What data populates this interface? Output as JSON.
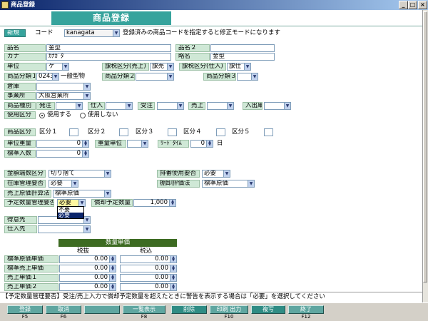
{
  "window": {
    "title": "商品登録",
    "min": "_",
    "max": "□",
    "close": "×"
  },
  "header": {
    "title": "商品登録"
  },
  "mode_badge": "新規",
  "code": {
    "label": "コード",
    "value": "kanagata",
    "hint": "登録済みの商品コードを指定すると修正モードになります"
  },
  "fields": {
    "hinmei": {
      "label": "品名",
      "value": "金型"
    },
    "hinmei2": {
      "label": "品名２",
      "value": ""
    },
    "kana": {
      "label": "カナ",
      "value": "ｶﾅｶﾞﾀ"
    },
    "ryakumei": {
      "label": "略名",
      "value": "金型"
    },
    "tani": {
      "label": "単位",
      "value": "ケ"
    },
    "tax_sales": {
      "label": "課税区分(売上)",
      "value": "課売"
    },
    "tax_purchase": {
      "label": "課税区分(仕入)",
      "value": "課仕"
    },
    "cat1": {
      "label": "商品分類１",
      "code": "0243",
      "name": "一般型物"
    },
    "cat2": {
      "label": "商品分類２",
      "value": ""
    },
    "cat3": {
      "label": "商品分類３",
      "value": ""
    },
    "souko": {
      "label": "倉庫",
      "value": ""
    },
    "jigyousho": {
      "label": "事業所",
      "value": "大阪営業所"
    },
    "shubetsu": {
      "label": "商品種別",
      "items": [
        {
          "label": "発注",
          "value": ""
        },
        {
          "label": "仕入",
          "value": ""
        },
        {
          "label": "受注",
          "value": ""
        },
        {
          "label": "売上",
          "value": ""
        },
        {
          "label": "入出庫",
          "value": ""
        }
      ]
    },
    "usage": {
      "label": "使用区分",
      "opt_use": "使用する",
      "opt_nouse": "使用しない"
    },
    "kubun": {
      "label": "商品区分",
      "items": [
        "区分１",
        "区分２",
        "区分３",
        "区分４",
        "区分５"
      ]
    },
    "tanijuryo": {
      "label": "単位重量",
      "value": "0"
    },
    "juryotani": {
      "label": "重量単位",
      "value": ""
    },
    "leadtime": {
      "label": "ﾘｰﾄﾞﾀｲﾑ",
      "value": "0",
      "unit": "日"
    },
    "hyojun_iri": {
      "label": "標準入数",
      "value": "0"
    },
    "hasu": {
      "label": "金額端数区分",
      "value": "切り捨て"
    },
    "haiban": {
      "label": "排番使用要否",
      "value": "必要"
    },
    "zaiko": {
      "label": "在庫管理要否",
      "value": "必要"
    },
    "tanaoroshi": {
      "label": "棚卸評価法",
      "value": "標準原価"
    },
    "urigenka": {
      "label": "売上原価計算法",
      "value": "標準原価"
    },
    "yotei": {
      "label": "予定数量管理要否",
      "value": "必要",
      "options": [
        "不要",
        "必要"
      ]
    },
    "shokyaku": {
      "label": "償却予定数量",
      "value": "1,000"
    },
    "tokuisaki": {
      "label": "得意先",
      "value": ""
    },
    "shiiresaki": {
      "label": "仕入先",
      "value": ""
    }
  },
  "price_table": {
    "title": "数量単価",
    "col_ex": "税抜",
    "col_in": "税込",
    "rows": [
      {
        "label": "標準原価単価",
        "ex": "0.00",
        "in": "0.00"
      },
      {
        "label": "標準売上単価",
        "ex": "0.00",
        "in": "0.00"
      },
      {
        "label": "売上単価１",
        "ex": "0.00",
        "in": "0.00"
      },
      {
        "label": "売上単価２",
        "ex": "0.00",
        "in": "0.00"
      }
    ]
  },
  "status": "【予定数量管理要否】受注/売上入力で償却予定数量を超えたときに警告を表示する場合は「必要」を選択してください",
  "fkeys": [
    {
      "label": "登録",
      "key": "F5"
    },
    {
      "label": "取消",
      "key": "F6"
    },
    {
      "label": "",
      "key": ""
    },
    {
      "label": "一覧表示",
      "key": "F8"
    },
    {
      "label": "削除",
      "key": ""
    },
    {
      "label": "印刷 出力",
      "key": "F10"
    },
    {
      "label": "複写",
      "key": ""
    },
    {
      "label": "終了",
      "key": "F12"
    }
  ]
}
